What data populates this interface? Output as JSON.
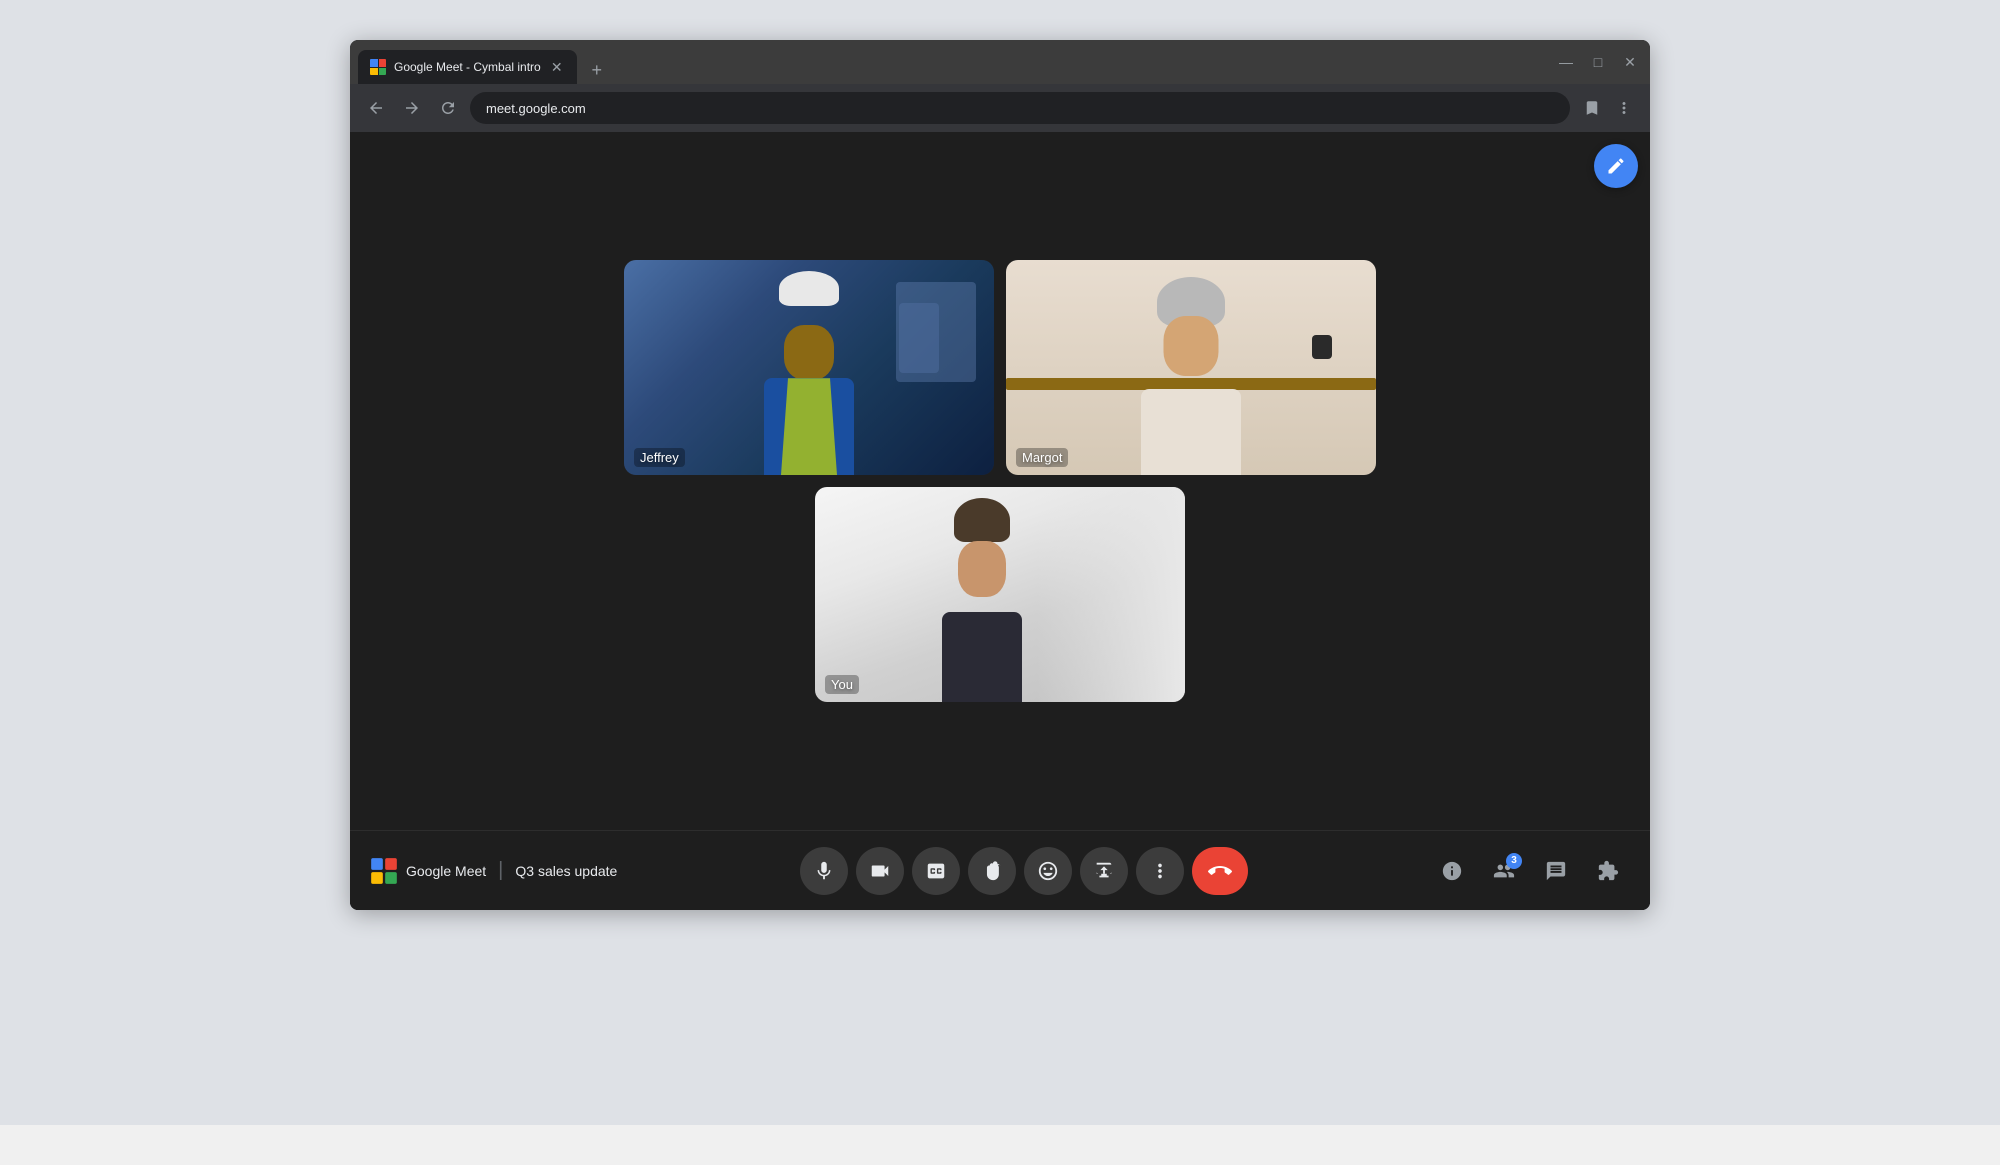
{
  "browser": {
    "tab_title": "Google Meet - Cymbal intro",
    "new_tab_symbol": "+",
    "address_url": "meet.google.com",
    "nav": {
      "back": "‹",
      "forward": "›",
      "reload": "↻"
    },
    "window_controls": {
      "minimize": "—",
      "maximize": "□",
      "close": "✕"
    }
  },
  "meet": {
    "app_name": "Google Meet",
    "meeting_title": "Q3 sales update",
    "participants": [
      {
        "name": "Jeffrey",
        "position": "top-left"
      },
      {
        "name": "Margot",
        "position": "top-right"
      },
      {
        "name": "You",
        "position": "bottom-center"
      }
    ],
    "participant_count": "3",
    "controls": {
      "mic": "mic",
      "camera": "videocam",
      "captions": "closed_caption",
      "raise_hand": "back_hand",
      "emoji": "sentiment_satisfied",
      "present": "present_to_all",
      "more": "more_vert",
      "end_call": "call_end"
    },
    "right_controls": {
      "info": "info",
      "people": "group",
      "chat": "chat",
      "activities": "extension"
    },
    "fab_icon": "✏️"
  }
}
